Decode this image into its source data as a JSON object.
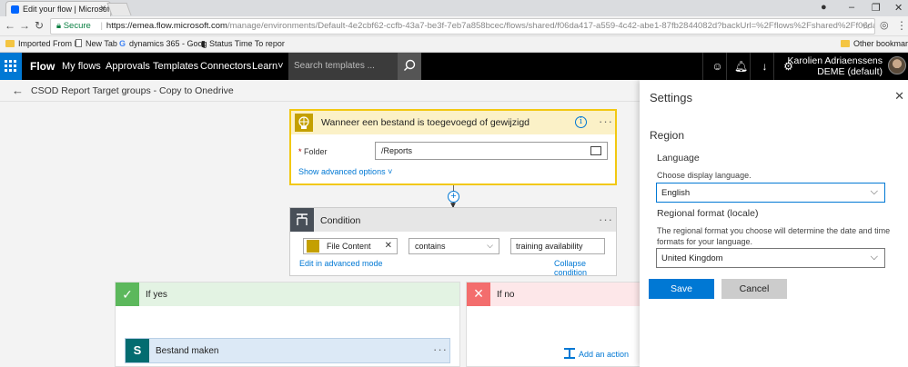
{
  "browser": {
    "tab_title": "Edit your flow | Microsoft",
    "secure_label": "Secure",
    "url_host": "https://emea.flow.microsoft.com",
    "url_path": "/manage/environments/Default-4e2cbf62-ccfb-43a7-be3f-7eb7a858bcec/flows/shared/f06da417-a559-4c42-abe1-87fb2844082d?backUrl=%2Fflows%2Fshared%2Ff06da417-a559-4c42-abe1-...",
    "bookmarks": [
      {
        "label": "Imported From IE",
        "icon": "folder-icon"
      },
      {
        "label": "New Tab",
        "icon": "page-icon"
      },
      {
        "label": "dynamics 365 - Goog",
        "icon": "google-icon"
      },
      {
        "label": "Status Time To repor",
        "icon": "chart-icon"
      }
    ],
    "other_bookmarks": "Other bookmarks"
  },
  "topnav": {
    "brand": "Flow",
    "items": [
      "My flows",
      "Approvals",
      "Templates",
      "Connectors",
      "Learn˅"
    ],
    "search_placeholder": "Search templates ...",
    "user_name": "Karolien Adriaenssens",
    "user_env": "DEME (default)"
  },
  "flow": {
    "name": "CSOD Report Target groups - Copy to Onedrive",
    "trigger": {
      "title": "Wanneer een bestand is toegevoegd of gewijzigd",
      "folder_label": "Folder",
      "folder_value": "/Reports",
      "advanced_link": "Show advanced options ˅"
    },
    "condition": {
      "title": "Condition",
      "token_label": "File Content",
      "operator": "contains",
      "value": "training availability",
      "edit_advanced": "Edit in advanced mode",
      "collapse": "Collapse condition"
    },
    "if_yes": {
      "title": "If yes",
      "action_title": "Bestand maken"
    },
    "if_no": {
      "title": "If no",
      "add_action": "Add an action"
    }
  },
  "settings": {
    "title": "Settings",
    "section": "Region",
    "language_label": "Language",
    "language_desc": "Choose display language.",
    "language_value": "English",
    "locale_label": "Regional format (locale)",
    "locale_desc": "The regional format you choose will determine the date and time formats for your language.",
    "locale_value": "United Kingdom",
    "save": "Save",
    "cancel": "Cancel"
  },
  "colors": {
    "accent": "#0078d4",
    "trigger_border": "#f2c811",
    "yes_green": "#5cb85c",
    "no_red": "#f36d6d"
  }
}
